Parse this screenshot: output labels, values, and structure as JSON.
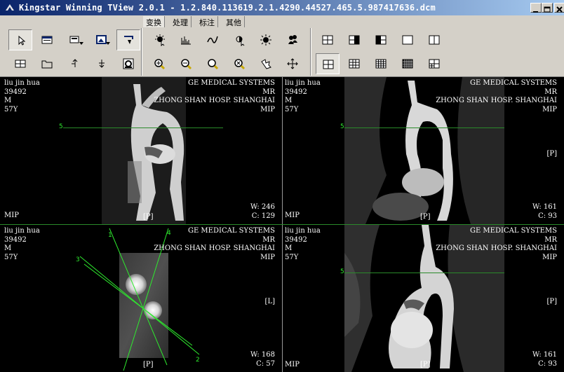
{
  "window": {
    "title": "Kingstar Winning TView 2.0.1 - 1.2.840.113619.2.1.4290.44527.465.5.987417636.dcm",
    "icon": "app-logo-icon",
    "buttons": [
      "minimize-icon",
      "maximize-icon",
      "close-icon"
    ]
  },
  "tabs": [
    {
      "label": "变换",
      "active": true
    },
    {
      "label": "处理",
      "active": false
    },
    {
      "label": "标注",
      "active": false
    },
    {
      "label": "其他",
      "active": false
    }
  ],
  "toolbar_icons": {
    "left_row1": [
      "pointer-icon",
      "window-icon",
      "layout-menu-icon",
      "image-menu-icon",
      "select-region-icon"
    ],
    "left_row2": [
      "grid-icon",
      "folder-icon",
      "arrow-up-left-icon",
      "arrow-down-icon",
      "film-icon"
    ],
    "mid_row1": [
      "brightness-cursor-icon",
      "histogram-icon",
      "curve-icon",
      "contrast-icon",
      "sun-icon",
      "people-icon"
    ],
    "mid_row2": [
      "zoom-in-icon",
      "zoom-out-icon",
      "magnifier-icon",
      "rotate-icon",
      "pan-hand-icon",
      "move-icon"
    ],
    "layout_row1": [
      "layout-2col-icon",
      "layout-left-dark-icon",
      "layout-right-dark-icon",
      "layout-single-icon",
      "layout-split-icon"
    ],
    "layout_row2": [
      "layout-2x2-icon",
      "layout-3x3-icon",
      "layout-4x4-icon",
      "layout-5x5-icon",
      "layout-mixed-icon"
    ]
  },
  "panes": [
    {
      "patient": "liu jin hua",
      "id": "39492",
      "sex": "M",
      "age": "57Y",
      "institution1": "GE MEDICAL SYSTEMS",
      "modality": "MR",
      "institution2": "ZHONG SHAN HOSP. SHANGHAI",
      "series": "MIP",
      "mip_label": "MIP",
      "orient_bottom": "[P]",
      "orient_right": "",
      "window_w": "W: 246",
      "window_c": "C: 129",
      "marker": "5"
    },
    {
      "patient": "liu jin hua",
      "id": "39492",
      "sex": "M",
      "age": "57Y",
      "institution1": "GE MEDICAL SYSTEMS",
      "modality": "MR",
      "institution2": "ZHONG SHAN HOSP. SHANGHAI",
      "series": "MIP",
      "mip_label": "MIP",
      "orient_bottom": "[P]",
      "orient_right": "[P]",
      "window_w": "W: 161",
      "window_c": "C: 93",
      "marker": "5"
    },
    {
      "patient": "liu jin hua",
      "id": "39492",
      "sex": "M",
      "age": "57Y",
      "institution1": "GE MEDICAL SYSTEMS",
      "modality": "MR",
      "institution2": "ZHONG SHAN HOSP. SHANGHAI",
      "series": "MIP",
      "mip_label": "",
      "orient_bottom": "[P]",
      "orient_right": "[L]",
      "window_w": "W: 168",
      "window_c": "C: 57",
      "line_labels": [
        "1",
        "2",
        "3",
        "4"
      ]
    },
    {
      "patient": "liu jin hua",
      "id": "39492",
      "sex": "M",
      "age": "57Y",
      "institution1": "GE MEDICAL SYSTEMS",
      "modality": "MR",
      "institution2": "ZHONG SHAN HOSP. SHANGHAI",
      "series": "MIP",
      "mip_label": "MIP",
      "orient_bottom": "[P]",
      "orient_right": "[P]",
      "window_w": "W: 161",
      "window_c": "C: 93",
      "marker": "5"
    }
  ],
  "colors": {
    "title_start": "#0a246a",
    "title_end": "#a6caf0",
    "toolbar": "#d4d0c8",
    "overlay_text": "#ffffff",
    "ref_line": "#2a8a2a",
    "ref_label": "#2eea2e"
  }
}
